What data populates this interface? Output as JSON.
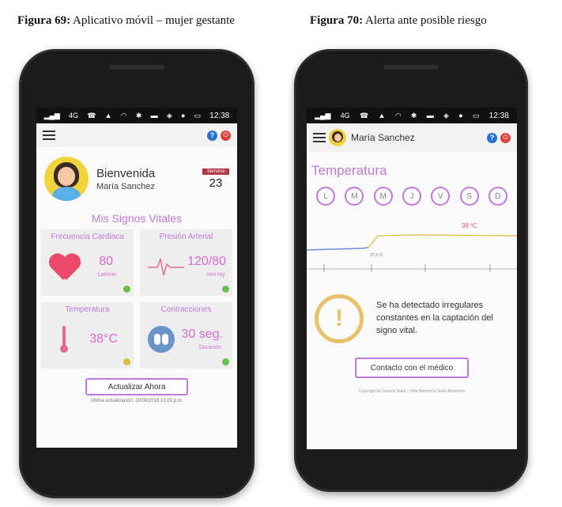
{
  "captions": {
    "fig69": {
      "label": "Figura 69:",
      "text": "Aplicativo móvil – mujer gestante"
    },
    "fig70": {
      "label": "Figura 70:",
      "text": "Alerta ante posible riesgo"
    }
  },
  "statusbar": {
    "network": "4G",
    "time": "12:38"
  },
  "screen1": {
    "welcome_title": "Bienvenida",
    "user_name": "María Sanchez",
    "week_label": "Semana",
    "week_value": "23",
    "section_title": "Mis Signos Vitales",
    "vitals": [
      {
        "title": "Frecuencia Cardiaca",
        "value": "80",
        "unit": "Lat/min",
        "icon": "heart-icon",
        "status": "green"
      },
      {
        "title": "Presión Arterial",
        "value": "120/80",
        "unit": "mm Hg",
        "icon": "pulse-icon",
        "status": "green"
      },
      {
        "title": "Temperatura",
        "value": "38°C",
        "unit": "",
        "icon": "thermometer-icon",
        "status": "yellow"
      },
      {
        "title": "Contracciones",
        "value": "30 seg.",
        "unit": "Duración",
        "icon": "feet-icon",
        "status": "green"
      }
    ],
    "update_button": "Actualizar Ahora",
    "last_update": "Última actualización: 20/08/2018 10:05 p.m."
  },
  "screen2": {
    "user_name": "María Sanchez",
    "section_title": "Temperatura",
    "days": [
      "L",
      "M",
      "M",
      "J",
      "V",
      "S",
      "D"
    ],
    "chart_label_high": "38 ºC",
    "chart_label_low": "37.3 ºC",
    "alert_text": "Se ha detectado irregulares constantes en la captación del signo vital.",
    "contact_button": "Contacto con el médico",
    "footnote": "Copyright de Gestión Natal – Villa Normal la Tarde Monitoreo"
  },
  "colors": {
    "accent_purple": "#c07ad6",
    "heart": "#ec4a6a",
    "alert": "#e7c26a",
    "chart_blue": "#6b8fd1",
    "chart_yellow": "#e5c659"
  }
}
